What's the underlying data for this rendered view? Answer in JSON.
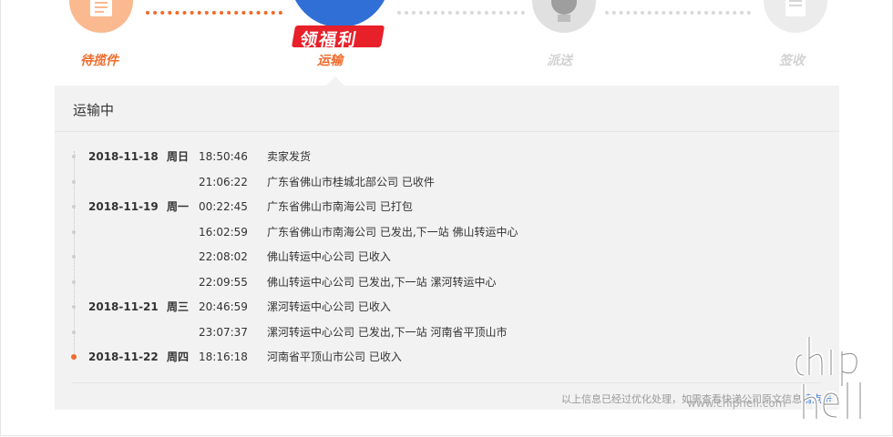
{
  "steps": [
    {
      "label": "待揽件",
      "state": "done",
      "icon": "document-icon"
    },
    {
      "label": "运输",
      "state": "current",
      "icon": "truck-icon",
      "promo_badge": "领福利"
    },
    {
      "label": "派送",
      "state": "pending",
      "icon": "courier-icon"
    },
    {
      "label": "签收",
      "state": "pending",
      "icon": "signed-document-icon"
    }
  ],
  "panel": {
    "title": "运输中",
    "events": [
      {
        "date": "2018-11-18",
        "weekday": "周日",
        "time": "18:50:46",
        "desc": "卖家发货"
      },
      {
        "date": "",
        "weekday": "",
        "time": "21:06:22",
        "desc": "广东省佛山市桂城北部公司 已收件"
      },
      {
        "date": "2018-11-19",
        "weekday": "周一",
        "time": "00:22:45",
        "desc": "广东省佛山市南海公司 已打包"
      },
      {
        "date": "",
        "weekday": "",
        "time": "16:02:59",
        "desc": "广东省佛山市南海公司 已发出,下一站 佛山转运中心"
      },
      {
        "date": "",
        "weekday": "",
        "time": "22:08:02",
        "desc": "佛山转运中心公司 已收入"
      },
      {
        "date": "",
        "weekday": "",
        "time": "22:09:55",
        "desc": "佛山转运中心公司 已发出,下一站 漯河转运中心"
      },
      {
        "date": "2018-11-21",
        "weekday": "周三",
        "time": "20:46:59",
        "desc": "漯河转运中心公司 已收入"
      },
      {
        "date": "",
        "weekday": "",
        "time": "23:07:37",
        "desc": "漯河转运中心公司 已发出,下一站 河南省平顶山市"
      },
      {
        "date": "2018-11-22",
        "weekday": "周四",
        "time": "18:16:18",
        "desc": "河南省平顶山市公司 已收入"
      }
    ],
    "footer_note": "以上信息已经过优化处理，如需查看快递公司原文信息",
    "footer_link": "请点击"
  },
  "watermark": {
    "url": "www.chiphell.com",
    "logo_text": "chiphell"
  },
  "colors": {
    "accent": "#f06b2a",
    "pending": "#d9d9d9",
    "panel_bg": "#f2f2f2",
    "link": "#3a7bd5",
    "badge": "#e8202a"
  }
}
